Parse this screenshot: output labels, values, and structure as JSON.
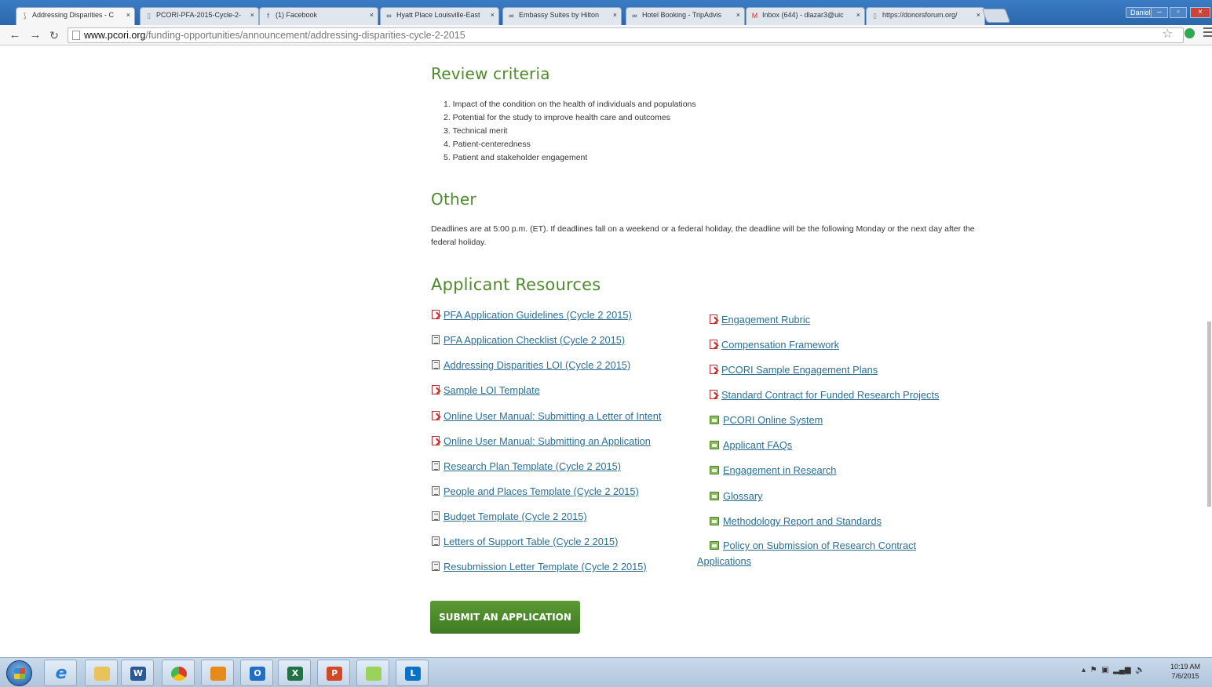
{
  "browser": {
    "tabs": [
      {
        "title": "Addressing Disparities - C",
        "icon": "pcori-icon",
        "active": true
      },
      {
        "title": "PCORI-PFA-2015-Cycle-2-",
        "icon": "page-icon"
      },
      {
        "title": "(1) Facebook",
        "icon": "facebook-icon"
      },
      {
        "title": "Hyatt Place Louisville-East",
        "icon": "tripadvisor-icon"
      },
      {
        "title": "Embassy Suites by Hilton",
        "icon": "tripadvisor-icon"
      },
      {
        "title": "Hotel Booking - TripAdvis",
        "icon": "tripadvisor-icon"
      },
      {
        "title": "Inbox (644) - dlazar3@uic",
        "icon": "gmail-icon"
      },
      {
        "title": "https://donorsforum.org/",
        "icon": "page-icon"
      }
    ],
    "user": "Danielle",
    "url_host": "www.pcori.org",
    "url_path": "/funding-opportunities/announcement/addressing-disparities-cycle-2-2015"
  },
  "page": {
    "review": {
      "heading": "Review criteria",
      "items": [
        "1.  Impact of the condition on the health of individuals and populations",
        "2.  Potential for the study to improve  health care and outcomes",
        "3.  Technical merit",
        "4.  Patient-centeredness",
        "5.  Patient and stakeholder engagement"
      ]
    },
    "other": {
      "heading": "Other",
      "text": "Deadlines are at 5:00 p.m. (ET). If deadlines fall on a weekend or a federal holiday, the deadline will be the following Monday or the next day after the federal holiday."
    },
    "resources": {
      "heading": "Applicant Resources",
      "left": [
        {
          "label": "PFA Application Guidelines (Cycle 2 2015)",
          "type": "pdf"
        },
        {
          "label": "PFA Application Checklist (Cycle 2 2015)",
          "type": "doc"
        },
        {
          "label": "Addressing Disparities LOI (Cycle 2 2015)",
          "type": "doc"
        },
        {
          "label": "Sample LOI Template",
          "type": "pdf"
        },
        {
          "label": "Online User Manual: Submitting a Letter of Intent",
          "type": "pdf"
        },
        {
          "label": "Online User Manual: Submitting an Application",
          "type": "pdf"
        },
        {
          "label": "Research Plan Template (Cycle 2 2015)",
          "type": "doc"
        },
        {
          "label": "People and Places Template (Cycle 2 2015)",
          "type": "doc"
        },
        {
          "label": "Budget Template (Cycle 2 2015)",
          "type": "doc"
        },
        {
          "label": "Letters of Support Table (Cycle 2 2015)",
          "type": "doc"
        },
        {
          "label": "Resubmission Letter Template (Cycle 2 2015)",
          "type": "doc"
        }
      ],
      "right": [
        {
          "label": "Engagement Rubric",
          "type": "pdf"
        },
        {
          "label": "Compensation Framework",
          "type": "pdf"
        },
        {
          "label": "PCORI Sample Engagement Plans",
          "type": "pdf"
        },
        {
          "label": "Standard Contract for Funded Research Projects",
          "type": "pdf"
        },
        {
          "label": "PCORI Online System",
          "type": "web"
        },
        {
          "label": "Applicant FAQs",
          "type": "web"
        },
        {
          "label": "Engagement in Research",
          "type": "web"
        },
        {
          "label": "Glossary",
          "type": "web"
        },
        {
          "label": "Methodology Report and Standards",
          "type": "web"
        },
        {
          "label": "Policy on Submission of Research Contract",
          "label2": "Applications",
          "type": "web"
        }
      ]
    },
    "submit_label": "SUBMIT AN APPLICATION"
  },
  "taskbar": {
    "apps": [
      {
        "name": "internet-explorer",
        "color": "#2a7fd4",
        "glyph": "e"
      },
      {
        "name": "file-explorer",
        "color": "#e8c35a",
        "glyph": ""
      },
      {
        "name": "word",
        "color": "#2b5797",
        "glyph": "W"
      },
      {
        "name": "chrome",
        "color": "#db3b2a",
        "glyph": ""
      },
      {
        "name": "media-player",
        "color": "#e68a1e",
        "glyph": ""
      },
      {
        "name": "outlook",
        "color": "#1f6fc4",
        "glyph": "O"
      },
      {
        "name": "excel",
        "color": "#217346",
        "glyph": "X"
      },
      {
        "name": "powerpoint",
        "color": "#d24726",
        "glyph": "P"
      },
      {
        "name": "sticky-notes",
        "color": "#9ad35a",
        "glyph": ""
      },
      {
        "name": "lync",
        "color": "#0a72c6",
        "glyph": "L"
      }
    ],
    "time": "10:19 AM",
    "date": "7/6/2015"
  }
}
